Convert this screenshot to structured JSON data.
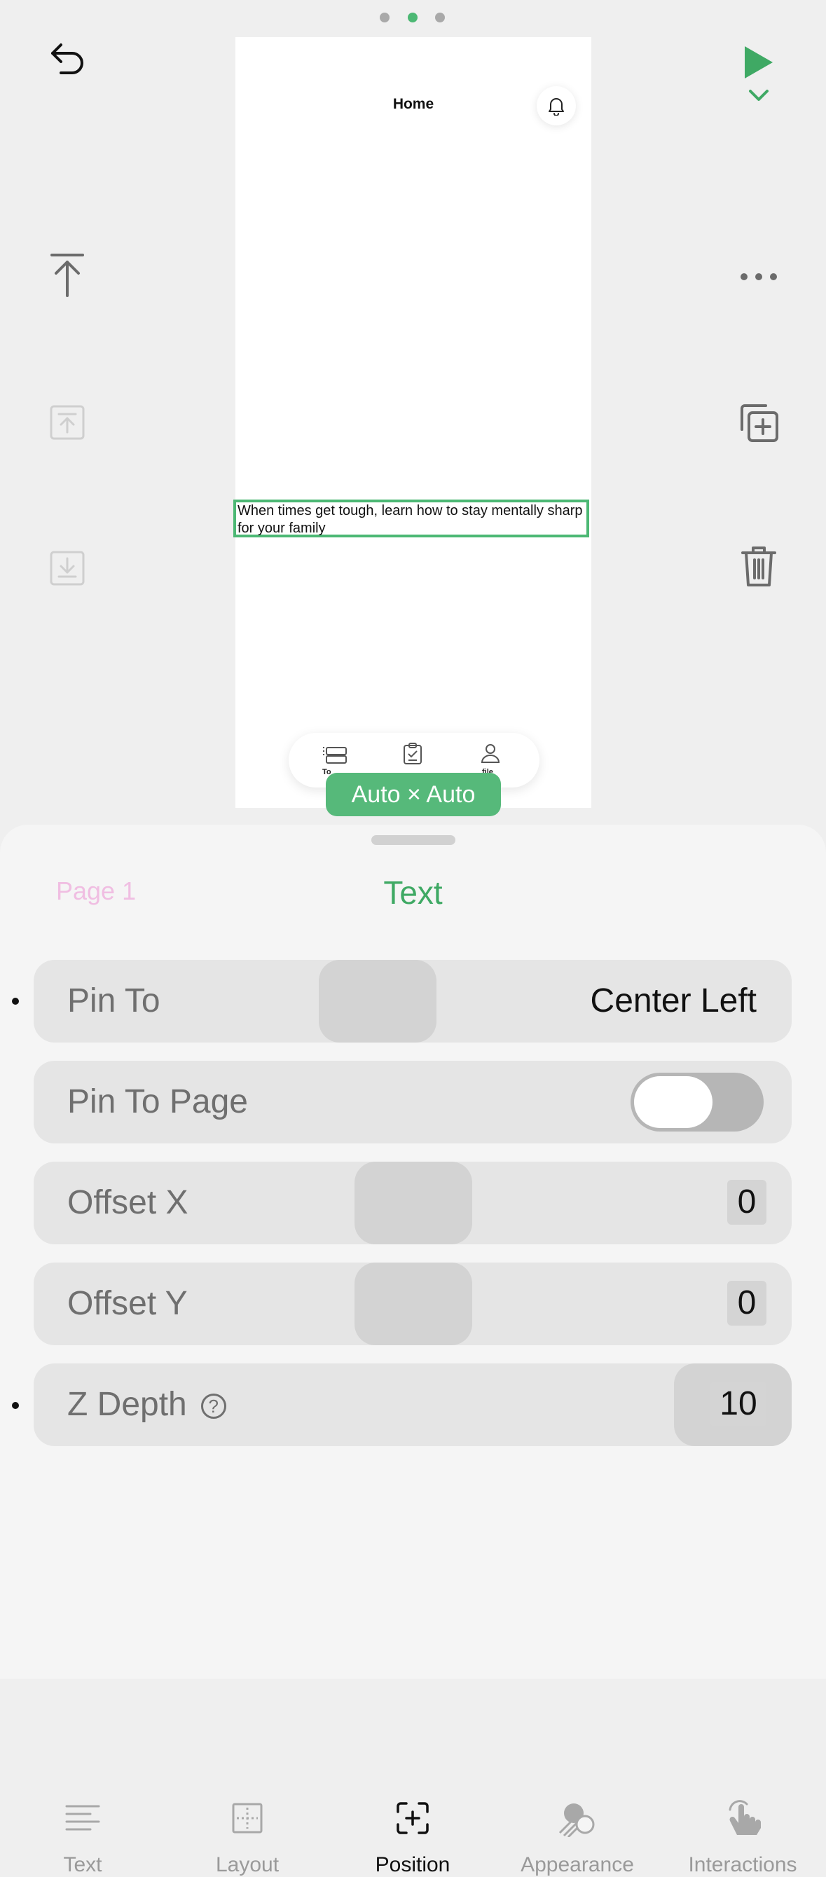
{
  "page_dots": [
    {
      "active": false
    },
    {
      "active": true
    },
    {
      "active": false
    }
  ],
  "colors": {
    "accent": "#4cb874",
    "pill": "#56b97a",
    "page_label": "#f0b9e0",
    "sheet_bg": "#f5f5f5",
    "row_bg": "#e5e5e5"
  },
  "toolbar": {
    "undo_icon": "undo-icon",
    "play_icon": "play-icon",
    "dropdown_icon": "chevron-down-icon",
    "move_top_icon": "move-to-top-icon",
    "move_up_icon": "move-up-icon",
    "move_down_icon": "move-down-icon",
    "more_icon": "more-icon",
    "duplicate_icon": "duplicate-icon",
    "delete_icon": "trash-icon"
  },
  "canvas": {
    "title": "Home",
    "selected_text": "When times get tough, learn how to stay mentally sharp for your family",
    "tabbar": {
      "items": [
        {
          "label": "To",
          "icon": "list-icon"
        },
        {
          "label": "",
          "icon": "clipboard-icon"
        },
        {
          "label": "file",
          "icon": "person-icon"
        }
      ]
    },
    "size_badge": "Auto × Auto"
  },
  "sheet": {
    "page_label": "Page 1",
    "title": "Text",
    "rows": {
      "pin_to": {
        "label": "Pin To",
        "value": "Center Left"
      },
      "pin_to_page": {
        "label": "Pin To Page",
        "on": false
      },
      "offset_x": {
        "label": "Offset X",
        "value": "0"
      },
      "offset_y": {
        "label": "Offset Y",
        "value": "0"
      },
      "z_depth": {
        "label": "Z Depth",
        "value": "10",
        "help": "?"
      }
    }
  },
  "bottom_tabs": [
    {
      "label": "Text",
      "icon": "text-lines-icon",
      "active": false
    },
    {
      "label": "Layout",
      "icon": "layout-icon",
      "active": false
    },
    {
      "label": "Position",
      "icon": "position-icon",
      "active": true
    },
    {
      "label": "Appearance",
      "icon": "appearance-icon",
      "active": false
    },
    {
      "label": "Interactions",
      "icon": "tap-hand-icon",
      "active": false
    }
  ]
}
